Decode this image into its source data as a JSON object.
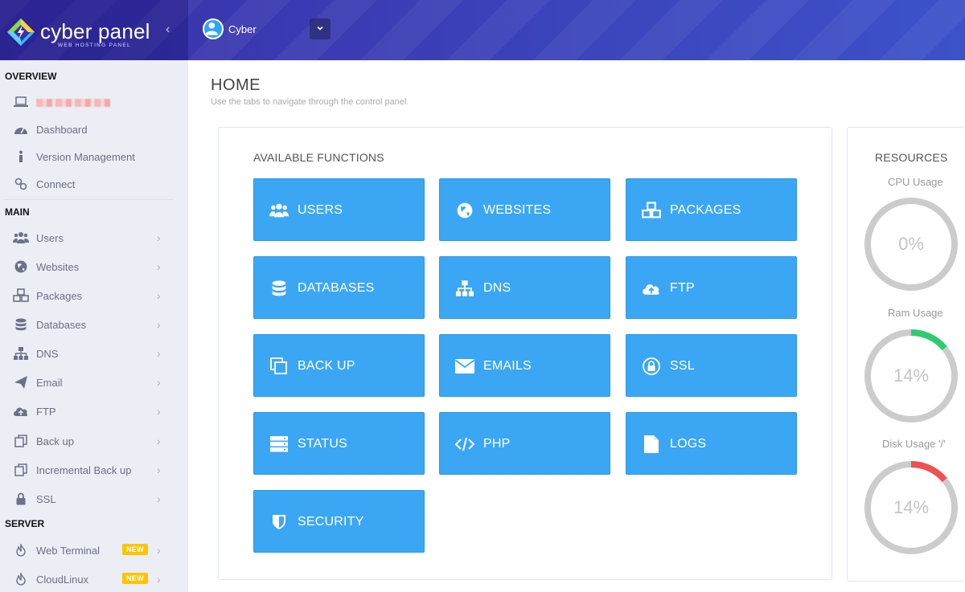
{
  "header": {
    "brand_name": "cyber panel",
    "brand_sub": "WEB HOSTING PANEL",
    "user_name": "Cyber"
  },
  "sidebar": {
    "sections": {
      "overview": "OVERVIEW",
      "main": "MAIN",
      "server": "SERVER"
    },
    "overview_items": [
      {
        "label": "Dashboard",
        "icon": "dashboard-icon"
      },
      {
        "label": "Version Management",
        "icon": "info-icon"
      },
      {
        "label": "Connect",
        "icon": "link-icon"
      }
    ],
    "main_items": [
      {
        "label": "Users",
        "icon": "users-icon"
      },
      {
        "label": "Websites",
        "icon": "globe-icon"
      },
      {
        "label": "Packages",
        "icon": "cubes-icon"
      },
      {
        "label": "Databases",
        "icon": "database-icon"
      },
      {
        "label": "DNS",
        "icon": "sitemap-icon"
      },
      {
        "label": "Email",
        "icon": "paper-plane-icon"
      },
      {
        "label": "FTP",
        "icon": "cloud-upload-icon"
      },
      {
        "label": "Back up",
        "icon": "copy-icon"
      },
      {
        "label": "Incremental Back up",
        "icon": "copy-icon"
      },
      {
        "label": "SSL",
        "icon": "lock-icon"
      }
    ],
    "server_items": [
      {
        "label": "Web Terminal",
        "icon": "fire-icon",
        "badge": "NEW"
      },
      {
        "label": "CloudLinux",
        "icon": "fire-icon",
        "badge": "NEW"
      }
    ]
  },
  "main": {
    "title": "HOME",
    "subtitle": "Use the tabs to navigate through the control panel.",
    "functions_title": "AVAILABLE FUNCTIONS",
    "functions": [
      {
        "label": "USERS",
        "icon": "users-icon"
      },
      {
        "label": "WEBSITES",
        "icon": "globe-icon"
      },
      {
        "label": "PACKAGES",
        "icon": "cubes-icon"
      },
      {
        "label": "DATABASES",
        "icon": "database-icon"
      },
      {
        "label": "DNS",
        "icon": "sitemap-icon"
      },
      {
        "label": "FTP",
        "icon": "cloud-upload-icon"
      },
      {
        "label": "BACK UP",
        "icon": "clone-icon"
      },
      {
        "label": "EMAILS",
        "icon": "envelope-icon"
      },
      {
        "label": "SSL",
        "icon": "lock-icon"
      },
      {
        "label": "STATUS",
        "icon": "server-icon"
      },
      {
        "label": "PHP",
        "icon": "code-icon"
      },
      {
        "label": "LOGS",
        "icon": "file-icon"
      },
      {
        "label": "SECURITY",
        "icon": "shield-icon"
      }
    ]
  },
  "resources": {
    "title": "RESOURCES",
    "cpu": {
      "label": "CPU Usage",
      "value_text": "0%",
      "percent": 0,
      "color": "#2ecc71"
    },
    "ram": {
      "label": "Ram Usage",
      "value_text": "14%",
      "percent": 14,
      "color": "#2ecc71"
    },
    "disk": {
      "label": "Disk Usage '/'",
      "value_text": "14%",
      "percent": 14,
      "color": "#f05050"
    }
  },
  "colors": {
    "button_blue": "#3ba7f4",
    "badge_yellow": "#ffc400",
    "gauge_track": "#cccccc"
  }
}
